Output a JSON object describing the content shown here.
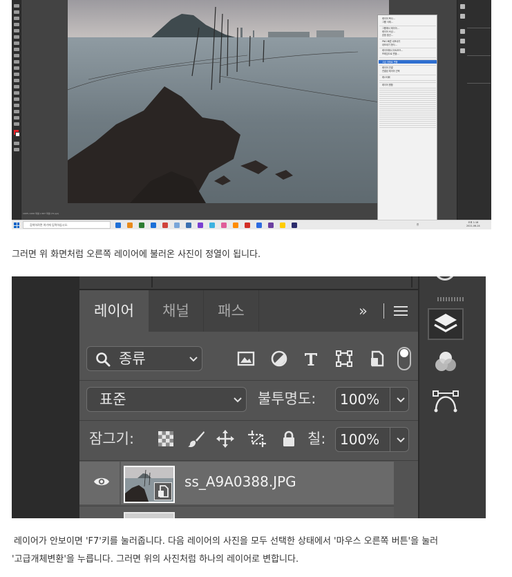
{
  "photoshop_window": {
    "context_menu_items": [
      "레이어 복사...",
      "그룹 삭제...",
      "",
      "그룹에서 레이어...",
      "레이어 속성...",
      "혼합 옵션...",
      "",
      "PNG 빠른 내보내기",
      "내보내기 형식...",
      "",
      "레이어에서 아트보드...",
      "프레임으로 변환...",
      "",
      "",
      "고급 개체로 변환",
      "",
      "레이어 연결",
      "연결된 레이어 선택",
      "",
      "래스터화",
      "",
      "",
      "레이어 병합",
      "",
      "",
      "",
      "",
      "",
      "",
      "",
      "",
      "",
      "",
      "",
      "",
      "",
      "",
      "",
      "",
      "",
      "",
      "",
      ""
    ],
    "highlighted_menu_item": "고급 개체로 변환",
    "canvas_status": "100%   1200 픽셀 x 667 픽셀 (72 ppi)",
    "taskbar": {
      "search_placeholder": "검색하려면 여기에 입력하십시오.",
      "clock_time": "오후 1:18",
      "clock_date": "2021-06-24",
      "tray_language": "한",
      "app_colors": [
        "#1f6fd6",
        "#e88a1a",
        "#2d7d32",
        "#1b6fd8",
        "#d0433b",
        "#7aa6d9",
        "#3a6fb0",
        "#7a3fd1",
        "#3cb2e0",
        "#e05d9a",
        "#ff8c00",
        "#d22f27",
        "#2d6be0",
        "#6b3fa0",
        "#ffcc00",
        "#2b2b6b"
      ]
    }
  },
  "caption_top": "그러면 위 화면처럼 오른쪽 레이어에 불러온 사진이 정열이 됩니다.",
  "layers_panel": {
    "tabs": [
      "레이어",
      "채널",
      "패스"
    ],
    "expand_glyph": "»",
    "filter_label": "종류",
    "blend_mode": "표준",
    "opacity_label": "불투명도:",
    "opacity_value": "100%",
    "lock_label": "잠그기:",
    "fill_label": "칠:",
    "fill_value": "100%",
    "layer_name": "ss_A9A0388.JPG"
  },
  "caption_bottom": {
    "line1": "레이어가 안보이면 'F7'키를 눌러줍니다. 다음 레이어의 사진을 모두 선택한 상태에서 '마우스 오른쪽 버튼'을 눌러",
    "line2": "'고급개체변환'을 누릅니다. 그러면 위의 사진처럼 하나의 레이어로 변합니다."
  },
  "colors": {
    "ps_dark": "#2e2e2e",
    "ps_panel": "#535353",
    "menu_highlight": "#2f6fd0",
    "layer_selected": "#6a6a6a"
  }
}
